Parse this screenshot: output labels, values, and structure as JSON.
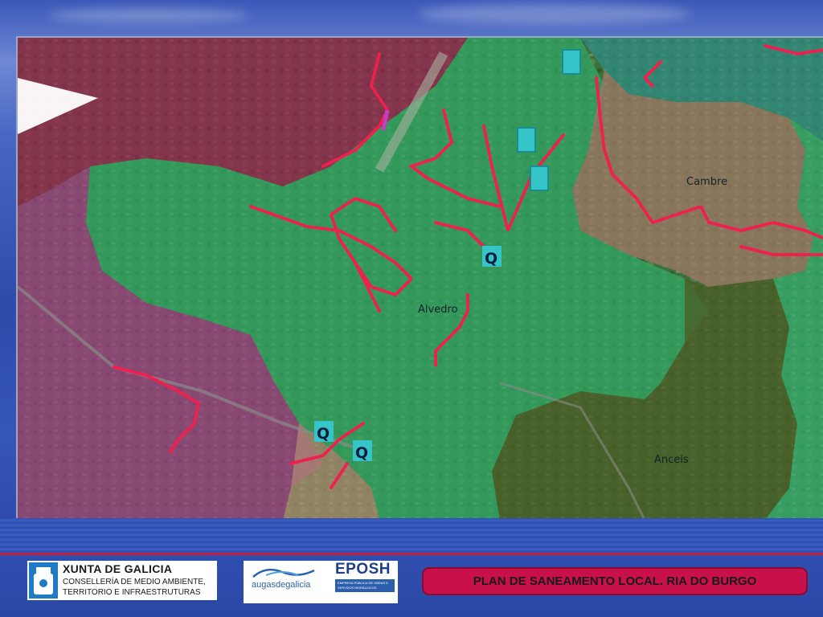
{
  "map": {
    "places": {
      "alvedro": "Alvedro",
      "cambre": "Cambre",
      "anceis": "Anceis"
    },
    "q_marker": "Q"
  },
  "footer": {
    "xunta_name": "XUNTA DE GALICIA",
    "xunta_dept_1": "CONSELLERÍA DE MEDIO AMBIENTE,",
    "xunta_dept_2": "TERRITORIO E INFRAESTRUTURAS",
    "augas_logo": "augasdegalicia",
    "eposh_logo": "EPOSH",
    "eposh_subtitle": "EMPRESA PÚBLICA DE OBRAS E SERVIZOS HIDRÁULICOS",
    "title": "PLAN DE SANEAMENTO LOCAL. RIA DO BURGO"
  },
  "colors": {
    "catchment_green": "#2fa866",
    "catchment_purple": "#a43a88",
    "catchment_maroon": "#9c1f52",
    "catchment_brown": "#9a7a6e",
    "network_red": "#f0204e",
    "station_cyan": "#35c4c8",
    "title_red": "#c8104a"
  }
}
